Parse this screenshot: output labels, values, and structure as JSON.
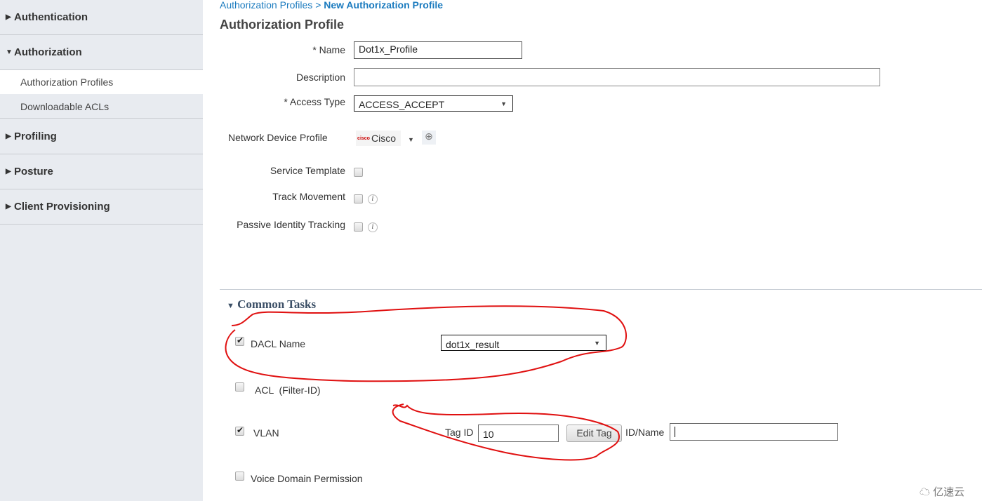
{
  "sidebar": {
    "sections": [
      {
        "label": "Authentication",
        "expanded": false
      },
      {
        "label": "Authorization",
        "expanded": true,
        "items": [
          {
            "label": "Authorization Profiles",
            "selected": true
          },
          {
            "label": "Downloadable ACLs"
          }
        ]
      },
      {
        "label": "Profiling",
        "expanded": false
      },
      {
        "label": "Posture",
        "expanded": false
      },
      {
        "label": "Client Provisioning",
        "expanded": false
      }
    ]
  },
  "breadcrumb": {
    "parent": "Authorization Profiles",
    "separator": ">",
    "current": "New Authorization Profile"
  },
  "page_title": "Authorization Profile",
  "form": {
    "name": {
      "label": "* Name",
      "value": "Dot1x_Profile"
    },
    "description": {
      "label": "Description",
      "value": ""
    },
    "access_type": {
      "label": "* Access Type",
      "value": "ACCESS_ACCEPT"
    },
    "network_device_profile": {
      "label": "Network Device Profile",
      "value": "Cisco",
      "logo_text": "cisco"
    },
    "service_template": {
      "label": "Service Template",
      "checked": false
    },
    "track_movement": {
      "label": "Track Movement",
      "checked": false,
      "info": "i"
    },
    "passive_identity": {
      "label": "Passive Identity Tracking",
      "checked": false,
      "info": "i"
    }
  },
  "common_tasks": {
    "title": "Common Tasks",
    "dacl": {
      "label": "DACL Name",
      "checked": true,
      "value": "dot1x_result"
    },
    "acl": {
      "label": "ACL  (Filter-ID)",
      "checked": false
    },
    "vlan": {
      "label": "VLAN",
      "checked": true,
      "tag_id_label": "Tag ID",
      "tag_id": "10",
      "edit_tag": "Edit Tag",
      "id_name_label": "ID/Name",
      "id_name": ""
    },
    "voice": {
      "label": "Voice Domain Permission",
      "checked": false
    }
  },
  "annotation_color": "#e01010",
  "watermark": "亿速云"
}
